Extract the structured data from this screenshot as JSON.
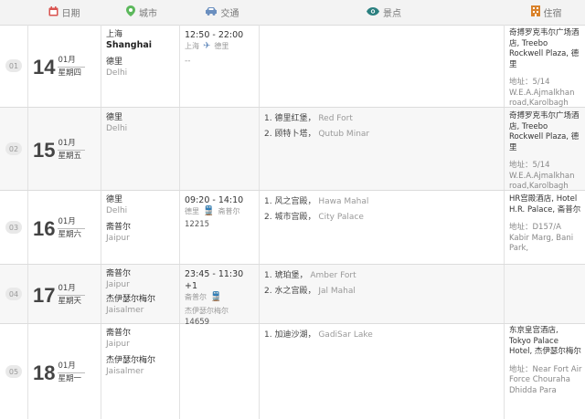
{
  "header": {
    "date": "日期",
    "city": "城市",
    "traffic": "交通",
    "scenic": "景点",
    "hotel": "住宿"
  },
  "colors": {
    "date_icon": "#d9534f",
    "city_icon": "#5cb85c",
    "traffic_icon": "#6a8fbf",
    "scenic_icon": "#2a7f7f",
    "hotel_icon": "#d9822b"
  },
  "rows": [
    {
      "no": "01",
      "day": "14",
      "month": "01月",
      "weekday": "星期四",
      "cities": [
        {
          "cn": "上海",
          "en": "Shanghai",
          "strong": true
        },
        {
          "cn": "德里",
          "en": "Delhi",
          "strong": false
        }
      ],
      "traffic": {
        "time": "12:50 - 22:00",
        "from": "上海",
        "to": "德里",
        "mode": "plane",
        "number": "",
        "note": "--"
      },
      "scenic": [],
      "hotel": {
        "name": "奇搏罗克韦尔广场酒店, Treebo Rockwell Plaza, 德里",
        "addr": "地址：5/14 W.E.A.Ajmalkhan road,Karolbagh"
      }
    },
    {
      "no": "02",
      "day": "15",
      "month": "01月",
      "weekday": "星期五",
      "cities": [
        {
          "cn": "德里",
          "en": "Delhi",
          "strong": false
        }
      ],
      "traffic": null,
      "scenic": [
        {
          "cn": "1. 德里红堡，",
          "en": "Red Fort"
        },
        {
          "cn": "2. 顾特卜塔，",
          "en": "Qutub Minar"
        }
      ],
      "hotel": {
        "name": "奇搏罗克韦尔广场酒店, Treebo Rockwell Plaza, 德里",
        "addr": "地址：5/14 W.E.A.Ajmalkhan road,Karolbagh"
      }
    },
    {
      "no": "03",
      "day": "16",
      "month": "01月",
      "weekday": "星期六",
      "cities": [
        {
          "cn": "德里",
          "en": "Delhi",
          "strong": false
        },
        {
          "cn": "斋普尔",
          "en": "Jaipur",
          "strong": false
        }
      ],
      "traffic": {
        "time": "09:20 - 14:10",
        "from": "德里",
        "to": "斋普尔",
        "mode": "train",
        "number": "12215",
        "note": ""
      },
      "scenic": [
        {
          "cn": "1. 风之宫殿，",
          "en": "Hawa Mahal"
        },
        {
          "cn": "2. 城市宫殿，",
          "en": "City Palace"
        }
      ],
      "hotel": {
        "name": "HR宫殿酒店, Hotel H.R. Palace, 斋普尔",
        "addr": "地址：D157/A Kabir Marg, Bani Park,"
      }
    },
    {
      "no": "04",
      "day": "17",
      "month": "01月",
      "weekday": "星期天",
      "cities": [
        {
          "cn": "斋普尔",
          "en": "Jaipur",
          "strong": false
        },
        {
          "cn": "杰伊瑟尔梅尔",
          "en": "Jaisalmer",
          "strong": false
        }
      ],
      "traffic": {
        "time": "23:45 - 11:30 +1",
        "from": "斋普尔",
        "to": "杰伊瑟尔梅尔",
        "mode": "train",
        "number": "14659",
        "note": ""
      },
      "scenic": [
        {
          "cn": "1. 琥珀堡，",
          "en": "Amber Fort"
        },
        {
          "cn": "2. 水之宫殿，",
          "en": "Jal Mahal"
        }
      ],
      "hotel": null
    },
    {
      "no": "05",
      "day": "18",
      "month": "01月",
      "weekday": "星期一",
      "cities": [
        {
          "cn": "斋普尔",
          "en": "Jaipur",
          "strong": false
        },
        {
          "cn": "杰伊瑟尔梅尔",
          "en": "Jaisalmer",
          "strong": false
        }
      ],
      "traffic": null,
      "scenic": [
        {
          "cn": "1. 加迪沙湖，",
          "en": "GadiSar Lake"
        }
      ],
      "hotel": {
        "name": "东京皇宫酒店, Tokyo Palace Hotel, 杰伊瑟尔梅尔",
        "addr": "地址：Near Fort Air Force Chouraha Dhidda Para"
      }
    }
  ]
}
